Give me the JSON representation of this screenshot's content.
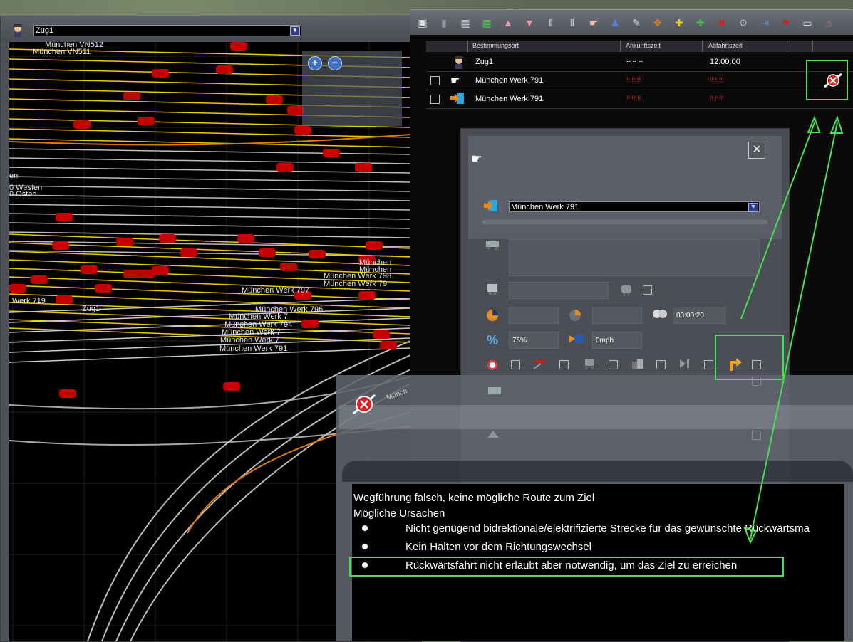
{
  "map_panel": {
    "train_select": "Zug1",
    "labels": {
      "vn512": "München VN512",
      "vn511": "München VN511",
      "westen_a": "en",
      "westen_b": "0 Westen",
      "osten": "0 Osten",
      "werk797": "München Werk 797",
      "werk798a": "München",
      "werk798b": "München",
      "werk798c": "München Werk 798",
      "werk798d": "München Werk 79",
      "werk719": "Werk 719",
      "zug1": "Zug1",
      "werk796": "München Werk 796",
      "werk_a": "München Werk 7",
      "werk_b": "München Werk 794",
      "werk_c": "München Werk 7",
      "werk_d": "München Werk 7",
      "werk791": "München Werk 791",
      "munch": "Münch"
    },
    "zoom_in": "+",
    "zoom_out": "−"
  },
  "toolbar": {
    "icons": [
      "save-icon",
      "trash-icon",
      "grid-small-icon",
      "grid-green-icon",
      "move-up-icon",
      "move-down-icon",
      "split-icon",
      "couple-icon",
      "hand-icon",
      "driver-icon",
      "edit-icon",
      "junction-icon",
      "add-yellow-icon",
      "add-green-icon",
      "delete-icon",
      "settings-icon",
      "exit-icon",
      "flag-icon",
      "wagon-icon",
      "station-icon"
    ]
  },
  "schedule": {
    "headers": {
      "dest": "Bestimmungsort",
      "arrival": "Ankunftszeit",
      "departure": "Abfahrtszeit"
    },
    "rows": [
      {
        "name": "Zug1",
        "arrival": "--:--:--",
        "departure": "12:00:00"
      },
      {
        "name": "München Werk 791",
        "arrival": "!!:!!:!!",
        "departure": "!!:!!:!!"
      },
      {
        "name": "München Werk 791",
        "arrival": "!!:!!:!!",
        "departure": "!!:!!:!!"
      }
    ]
  },
  "order_dialog": {
    "close": "×",
    "destination": "München Werk 791",
    "time_value": "00:00:20",
    "percent_symbol": "%",
    "percent_value": "75%",
    "speed_value": "0mph"
  },
  "message": {
    "title": "Wegführung falsch, keine mögliche Route zum Ziel",
    "causes_label": "Mögliche Ursachen",
    "causes": [
      "Nicht genügend bidrektionale/elektrifizierte Strecke für das gewünschte Rückwärtsma",
      "Kein Halten vor dem Richtungswechsel",
      "Rückwärtsfahrt nicht erlaubt aber notwendig, um das Ziel zu erreichen"
    ]
  },
  "colors": {
    "highlight": "#46e052",
    "track_yellow": "#f0c800",
    "train_red": "#c40000",
    "track_orange": "#e07a10"
  }
}
